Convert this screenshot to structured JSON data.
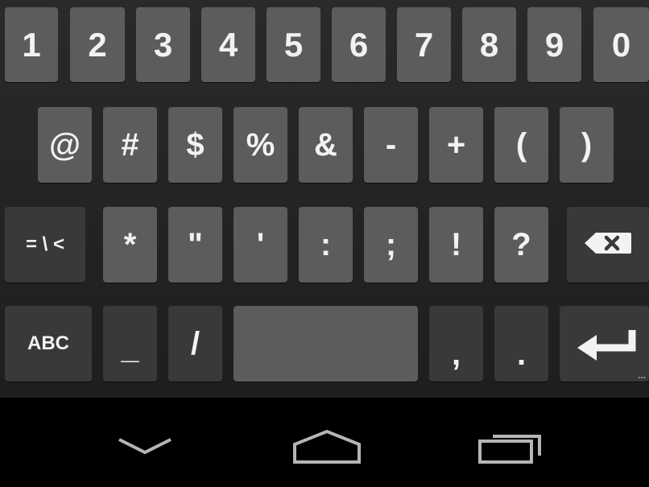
{
  "keyboard": {
    "row1": [
      "1",
      "2",
      "3",
      "4",
      "5",
      "6",
      "7",
      "8",
      "9",
      "0"
    ],
    "row2": [
      "@",
      "#",
      "$",
      "%",
      "&",
      "-",
      "+",
      "(",
      ")"
    ],
    "row3": {
      "mode_key": "= \\ <",
      "keys": [
        "*",
        "\"",
        "'",
        ":",
        ";",
        "!",
        "?"
      ],
      "backspace_icon": "backspace-icon"
    },
    "row4": {
      "abc_key": "ABC",
      "underscore": "_",
      "slash": "/",
      "comma": ",",
      "period": ".",
      "enter_icon": "enter-icon",
      "more_indicator": "..."
    }
  },
  "navbar": {
    "back_icon": "back-chevron-icon",
    "home_icon": "home-icon",
    "recents_icon": "recent-apps-icon"
  },
  "colors": {
    "key_light": "#5c5c5c",
    "key_dark": "#393939",
    "keyboard_bg": "#222222",
    "nav_bg": "#000000",
    "label": "#f2f2f2"
  }
}
